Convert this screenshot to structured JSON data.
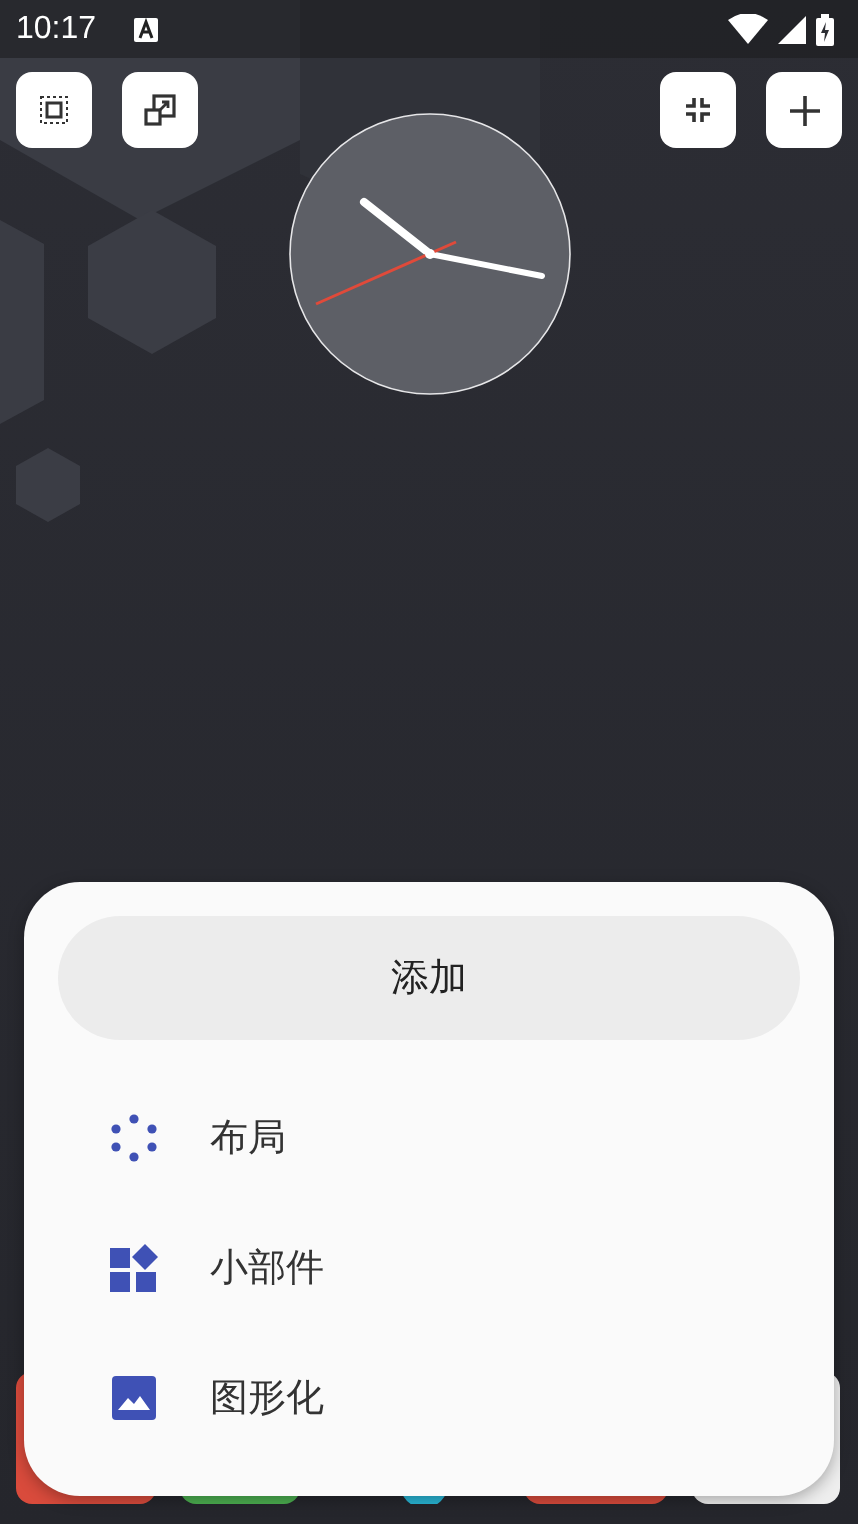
{
  "status_bar": {
    "time": "10:17"
  },
  "toolbar": {
    "left_buttons": [
      {
        "kind": "select"
      },
      {
        "kind": "resize"
      }
    ],
    "right_buttons": [
      {
        "kind": "collapse"
      },
      {
        "kind": "add"
      }
    ]
  },
  "sheet": {
    "title": "添加",
    "items": [
      {
        "kind": "layout",
        "label": "布局"
      },
      {
        "kind": "widget",
        "label": "小部件"
      },
      {
        "kind": "image",
        "label": "图形化"
      }
    ]
  }
}
